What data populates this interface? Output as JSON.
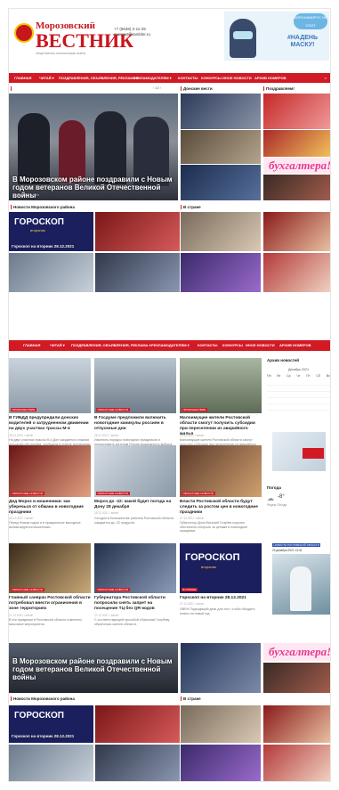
{
  "header": {
    "logo_line1": "Морозовский",
    "logo_line2": "ВЕСТНИК",
    "logo_sub": "общественно-политическая газета",
    "phone": "+7 (8638) 2-11-35",
    "email": "morvest@rambler.ru",
    "banner_stamp": "КОРОНАВИРУС НЕ СПИТ",
    "banner_text": "#НАДЕНЬ МАСКУ!"
  },
  "nav": {
    "items": [
      "ГЛАВНАЯ",
      "ЧИТАЙ ▾",
      "ПОЗДРАВЛЕНИЯ, ОБЪЯВЛЕНИЯ, РЕКЛАМА ▾",
      "РЕКЛАМОДАТЕЛЯМ ▾",
      "КОНТАКТЫ",
      "КОНКУРСЫ",
      "ИНОЕ НОВОСТИ",
      "АРХИВ НОМЕРОВ"
    ],
    "search_icon": "search-icon"
  },
  "top": {
    "hero_caption": "В Морозовском районе поздравили с Новым годом ветеранов Великой Отечественной войны",
    "hero_date": "29.12.2021 / admin",
    "donskie_title": "Донские вести",
    "podr_title": "Поздравляем!",
    "buh_text": "бухгалтера!",
    "pager": "‹ 1/2 ›"
  },
  "regional": {
    "title": "Новости Морозовского района",
    "horoscope_title": "ГОРОСКОП",
    "horoscope_sub": "втораник",
    "horoscope_caption": "Гороскоп на вторник 28.12.2021",
    "country_title": "В стране"
  },
  "grid": {
    "cards": [
      {
        "tag1": "ПРОИСШЕСТВИЯ",
        "tag2": "ОБЛАСТНЫЕ НОВОСТИ",
        "title": "В ГИБДД предупредили донских водителей о затрудненном движении на двух участках трассы М-4",
        "date": "28.12.2021 / admin",
        "text": "На двух участках трассы М-4 Дон ожидается сложная дорожная обстановка, сообщили в отделе пропаганды Госавтоинспекции Ростовской области."
      },
      {
        "tag1": "ОБЛАСТНЫЕ НОВОСТИ",
        "tag2": "",
        "title": "В Госдуме предложили включить новогодние каникулы россиян в отпускные дни",
        "date": "28.12.2021 / admin",
        "text": "Изменить порядок новогодних праздников и предоставить жителям России возможность выбора, предложили в Госдуме."
      },
      {
        "tag1": "ПРОИСШЕСТВИЯ",
        "tag2": "ОБЛАСТНЫЕ НОВОСТИ",
        "title": "Малоимущие жители Ростовской области смогут получить субсидии при переселении из аварийного жилья",
        "date": "28.12.2021 / admin",
        "text": "Малоимущие жители Ростовской области смогут получить субсидии при переселении из аварийного жилья."
      },
      {
        "tag1": "ОБЛАСТНЫЕ НОВОСТИ",
        "tag2": "В СТРАНЕ",
        "title": "Дед Мороз и мошенники: как уберечься от обмана в новогодние праздники",
        "date": "28.12.2021 / admin",
        "text": "Перед Новым годом и в праздничные выходные активизируются мошенники."
      },
      {
        "tag1": "ОБЛАСТНЫЕ НОВОСТИ",
        "tag2": "",
        "title": "Мороз до -22: какой будет погода на Дону 28 декабря",
        "date": "28.12.2021 / admin",
        "text": "Сегодня в большинстве районов Ростовской области ожидается до -22 градусов."
      },
      {
        "tag1": "ОБЛАСТНЫЕ НОВОСТИ",
        "tag2": "",
        "title": "Власти Ростовской области будут следить за ростом цен в новогодние праздники",
        "date": "27.12.2021 / admin",
        "text": "Губернатор Дона Василий Голубев поручил обеспечить контроль за ценами в новогодние праздники."
      },
      {
        "tag1": "ОБЛАСТНЫЕ НОВОСТИ",
        "tag2": "",
        "title": "Главный санврач Ростовской области потребовал ввести ограничения в зоне территориях",
        "date": "27.12.2021 / admin",
        "text": "В эти праздники в Ростовской области отменены массовые мероприятия."
      },
      {
        "tag1": "ОБЛАСТНЫЕ НОВОСТИ",
        "tag2": "В СТРАНЕ",
        "title": "Губернатора Ростовской области попросили снять запрет на посещение ТЦ без QR-кодов",
        "date": "27.12.2021 / admin",
        "text": "С соответствующей просьбой к Василию Голубеву обратились жители области."
      },
      {
        "tag1": "В СТРАНЕ",
        "tag2": "",
        "title": "Гороскоп на вторник 28.12.2021",
        "date": "27.12.2021 / admin",
        "text": "ОВЕН Подходящий день для того, чтобы обсудить планы на новый год."
      }
    ]
  },
  "sidebar": {
    "archive_title": "Архив новостей",
    "month": "Декабрь 2021",
    "weekdays": [
      "Пн",
      "Вт",
      "Ср",
      "Чт",
      "Пт",
      "Сб",
      "Вс"
    ],
    "weather_title": "Погода",
    "weather_temp": "-8°",
    "weather_source": "Яндекс.Погода",
    "covid_tag": "НОВОСТИ РОСТОВСКОЙ ОБЛАСТИ",
    "covid_date": "23 декабря 2021 13:42"
  }
}
